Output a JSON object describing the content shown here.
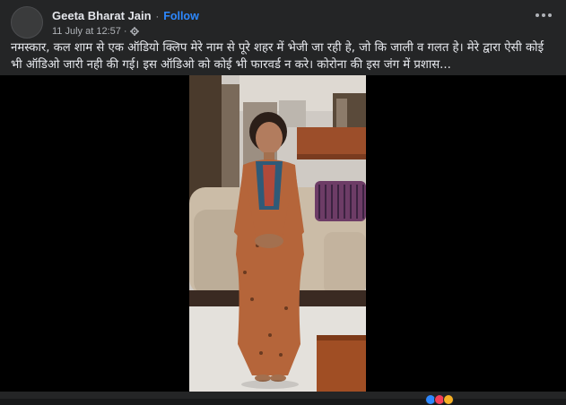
{
  "post": {
    "author": "Geeta Bharat Jain",
    "separator": "·",
    "follow_label": "Follow",
    "timestamp": "11 July at 12:57",
    "timestamp_sep": "·",
    "privacy_icon": "gear-icon",
    "caption": "नमस्कार, कल शाम से एक ऑडियो क्लिप मेरे नाम से पूरे शहर में भेजी जा रही हे, जो कि जाली व गलत हे। मेरे द्वारा ऐसी कोई भी ऑडिओ जारी नही की गई। इस ऑडिओ को कोई भी फारवर्ड न करे। कोरोना की इस जंग में प्रशास..."
  },
  "colors": {
    "background": "#242526",
    "text": "#e4e6eb",
    "muted": "#b0b3b8",
    "link": "#2d88ff",
    "media_bg": "#000000"
  },
  "media": {
    "type": "video",
    "description_icon": "video-player"
  }
}
